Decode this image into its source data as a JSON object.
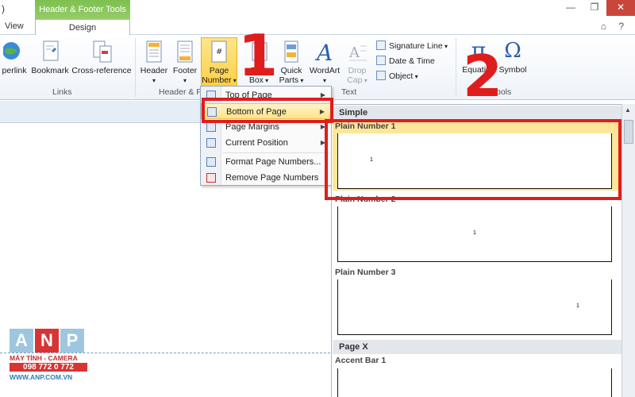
{
  "window": {
    "left_char": ")",
    "contextual_title": "Header & Footer Tools",
    "controls": {
      "minimize": "—",
      "restore": "❐",
      "close": "✕"
    }
  },
  "tabs": {
    "view": "View",
    "design": "Design",
    "right_glyphs": "⌂ ?"
  },
  "ribbon": {
    "links_group": {
      "label": "Links",
      "buttons": [
        "perlink",
        "Bookmark",
        "Cross-reference"
      ]
    },
    "hf_group": {
      "label": "Header & F",
      "header": "Header",
      "footer": "Footer",
      "page_number_line1": "Page",
      "page_number_line2": "Number"
    },
    "text_group": {
      "label": "Text",
      "text_box_1": "Text",
      "text_box_2": "Box",
      "quick_parts_1": "Quick",
      "quick_parts_2": "Parts",
      "wordart": "WordArt",
      "drop_cap_1": "Drop",
      "drop_cap_2": "Cap",
      "signature_line": "Signature Line",
      "date_time": "Date & Time",
      "object": "Object"
    },
    "symbols_group": {
      "label": "Symbols",
      "equation": "Equation",
      "symbol": "Symbol",
      "pi_glyph": "π",
      "omega_glyph": "Ω"
    }
  },
  "menu": {
    "items": [
      {
        "label": "Top of Page",
        "submenu": true
      },
      {
        "label": "Bottom of Page",
        "submenu": true
      },
      {
        "label": "Page Margins",
        "submenu": true
      },
      {
        "label": "Current Position",
        "submenu": true
      },
      {
        "label": "Format Page Numbers...",
        "submenu": false
      },
      {
        "label": "Remove Page Numbers",
        "submenu": false
      }
    ]
  },
  "gallery": {
    "section_simple": "Simple",
    "items": [
      {
        "title": "Plain Number 1",
        "num": "1"
      },
      {
        "title": "Plain Number 2",
        "num": "1"
      },
      {
        "title": "Plain Number 3",
        "num": "1"
      }
    ],
    "section_pagex": "Page X",
    "accent_title": "Accent Bar 1"
  },
  "annotations": {
    "step1": "1",
    "step2": "2",
    "color": "#e01d1d"
  },
  "watermark": {
    "letters": [
      "A",
      "N",
      "P"
    ],
    "line1": "MÁY TÍNH - CAMERA",
    "phone": "098 772 0 772",
    "site": "WWW.ANP.COM.VN"
  }
}
